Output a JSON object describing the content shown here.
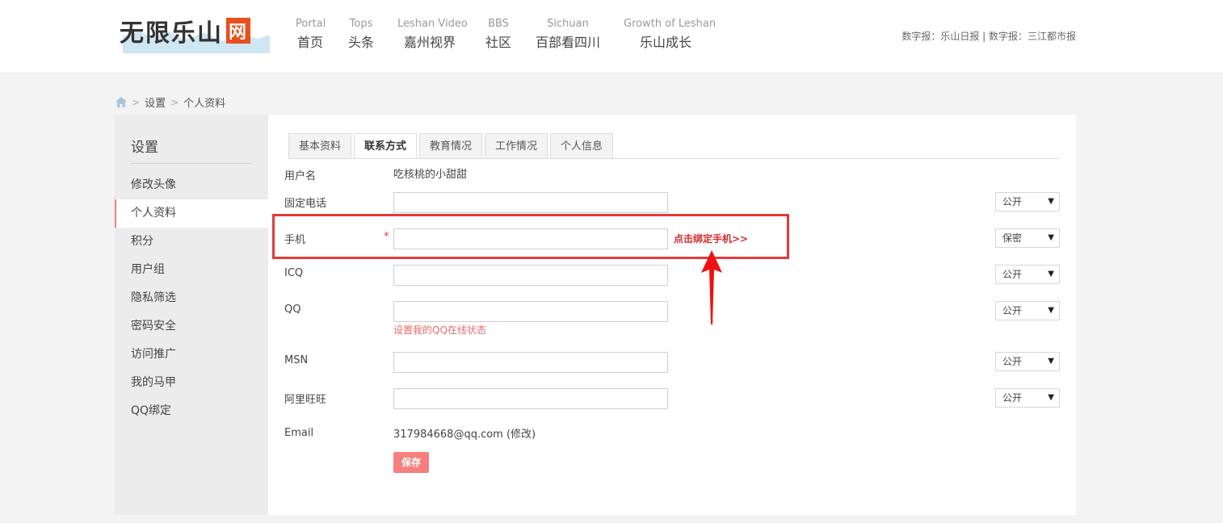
{
  "header": {
    "logo_text": "无限乐山",
    "logo_badge": "网",
    "nav": [
      {
        "en": "Portal",
        "cn": "首页"
      },
      {
        "en": "Tops",
        "cn": "头条"
      },
      {
        "en": "Leshan Video",
        "cn": "嘉州视界"
      },
      {
        "en": "BBS",
        "cn": "社区"
      },
      {
        "en": "Sichuan",
        "cn": "百部看四川"
      },
      {
        "en": "Growth of Leshan",
        "cn": "乐山成长"
      }
    ],
    "digital": "数字报：乐山日报 | 数字报：三江都市报"
  },
  "breadcrumb": {
    "sep1": ">",
    "item1": "设置",
    "sep2": ">",
    "item2": "个人资料"
  },
  "sidebar": {
    "title": "设置",
    "items": [
      {
        "label": "修改头像"
      },
      {
        "label": "个人资料"
      },
      {
        "label": "积分"
      },
      {
        "label": "用户组"
      },
      {
        "label": "隐私筛选"
      },
      {
        "label": "密码安全"
      },
      {
        "label": "访问推广"
      },
      {
        "label": "我的马甲"
      },
      {
        "label": "QQ绑定"
      }
    ]
  },
  "tabs": [
    {
      "label": "基本资料"
    },
    {
      "label": "联系方式"
    },
    {
      "label": "教育情况"
    },
    {
      "label": "工作情况"
    },
    {
      "label": "个人信息"
    }
  ],
  "form": {
    "username_label": "用户名",
    "username_value": "吃核桃的小甜甜",
    "landline_label": "固定电话",
    "landline_privacy": "公开",
    "mobile_label": "手机",
    "mobile_required": "*",
    "mobile_bind_link": "点击绑定手机>>",
    "mobile_privacy": "保密",
    "icq_label": "ICQ",
    "icq_privacy": "公开",
    "qq_label": "QQ",
    "qq_privacy": "公开",
    "qq_status_link": "设置我的QQ在线状态",
    "msn_label": "MSN",
    "msn_privacy": "公开",
    "aliww_label": "阿里旺旺",
    "aliww_privacy": "公开",
    "email_label": "Email",
    "email_value": "317984668@qq.com",
    "email_modify": "(修改)",
    "save_label": "保存",
    "caret": "▼"
  },
  "colors": {
    "accent": "#f77f80",
    "highlight": "#e23b3b",
    "link_red": "#d42c2c"
  }
}
